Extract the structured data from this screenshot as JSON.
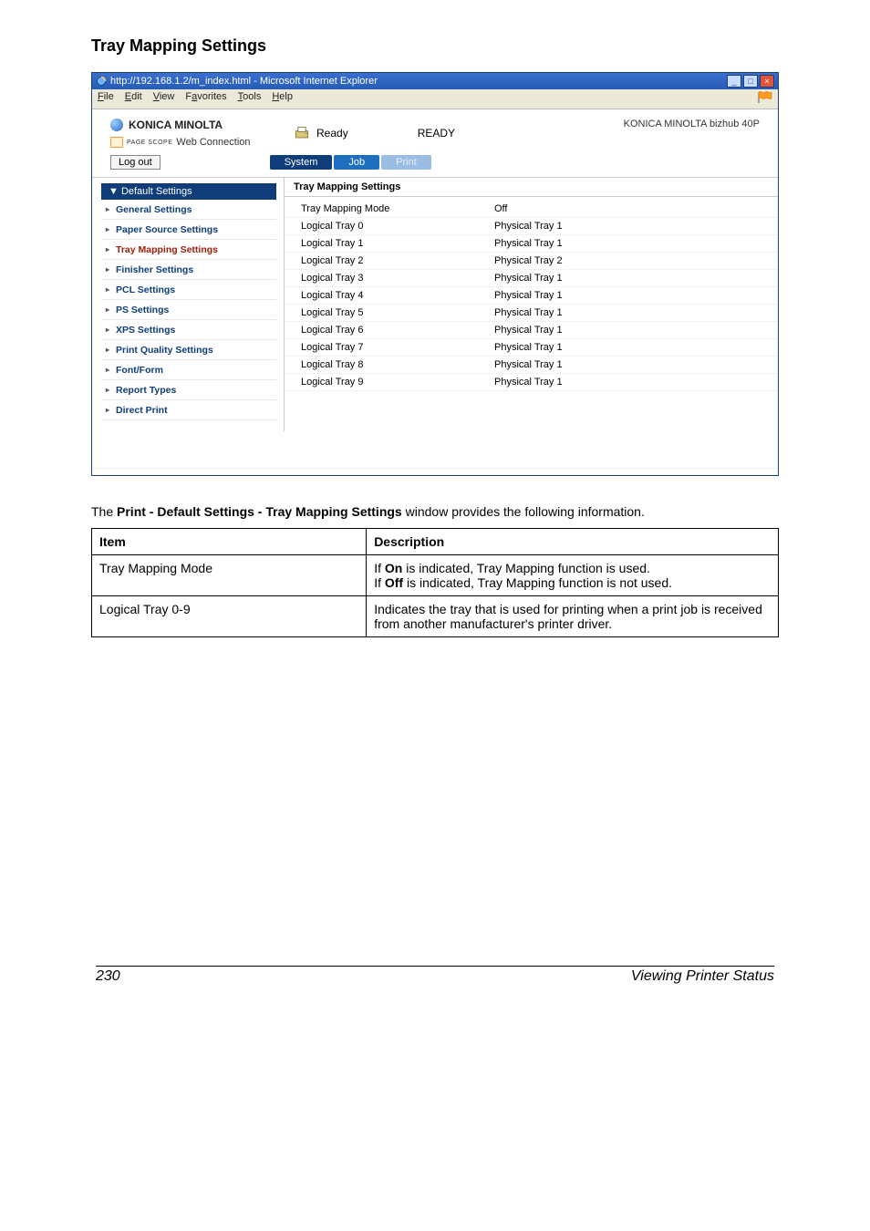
{
  "heading": "Tray Mapping Settings",
  "ie": {
    "title": "http://192.168.1.2/m_index.html - Microsoft Internet Explorer",
    "menu": [
      "File",
      "Edit",
      "View",
      "Favorites",
      "Tools",
      "Help"
    ]
  },
  "header": {
    "brand": "KONICA MINOLTA",
    "pagescope_prefix": "PAGE SCOPE",
    "pagescope_label": "Web Connection",
    "status_icon_label": "Ready",
    "status_text": "READY",
    "model": "KONICA MINOLTA bizhub 40P",
    "logout": "Log out",
    "tabs": {
      "system": "System",
      "job": "Job",
      "print": "Print"
    }
  },
  "sidebar": {
    "head": "▼ Default Settings",
    "items": [
      {
        "label": "General Settings"
      },
      {
        "label": "Paper Source Settings"
      },
      {
        "label": "Tray Mapping Settings",
        "active": true
      },
      {
        "label": "Finisher Settings"
      },
      {
        "label": "PCL Settings"
      },
      {
        "label": "PS Settings"
      },
      {
        "label": "XPS Settings"
      },
      {
        "label": "Print Quality Settings"
      }
    ],
    "roots": [
      {
        "label": "Font/Form"
      },
      {
        "label": "Report Types"
      },
      {
        "label": "Direct Print"
      }
    ]
  },
  "panel": {
    "title": "Tray Mapping Settings",
    "rows": [
      {
        "k": "Tray Mapping Mode",
        "v": "Off"
      },
      {
        "k": "Logical Tray 0",
        "v": "Physical Tray 1"
      },
      {
        "k": "Logical Tray 1",
        "v": "Physical Tray 1"
      },
      {
        "k": "Logical Tray 2",
        "v": "Physical Tray 2"
      },
      {
        "k": "Logical Tray 3",
        "v": "Physical Tray 1"
      },
      {
        "k": "Logical Tray 4",
        "v": "Physical Tray 1"
      },
      {
        "k": "Logical Tray 5",
        "v": "Physical Tray 1"
      },
      {
        "k": "Logical Tray 6",
        "v": "Physical Tray 1"
      },
      {
        "k": "Logical Tray 7",
        "v": "Physical Tray 1"
      },
      {
        "k": "Logical Tray 8",
        "v": "Physical Tray 1"
      },
      {
        "k": "Logical Tray 9",
        "v": "Physical Tray 1"
      }
    ]
  },
  "blurb": {
    "pre": "The ",
    "bold": "Print - Default Settings - Tray Mapping Settings",
    "post": " window provides the following information."
  },
  "infotable": {
    "h1": "Item",
    "h2": "Description",
    "rows": [
      {
        "item": "Tray Mapping Mode",
        "d_pre1": "If ",
        "d_b1": "On",
        "d_post1": " is indicated, Tray Mapping function is used.",
        "d_pre2": "If ",
        "d_b2": "Off",
        "d_post2": " is indicated, Tray Mapping function is not used."
      },
      {
        "item": "Logical Tray 0-9",
        "d_plain": "Indicates the tray that is used for printing when a print job is received from another manufacturer's printer driver."
      }
    ]
  },
  "footer": {
    "page": "230",
    "title": "Viewing Printer Status"
  }
}
